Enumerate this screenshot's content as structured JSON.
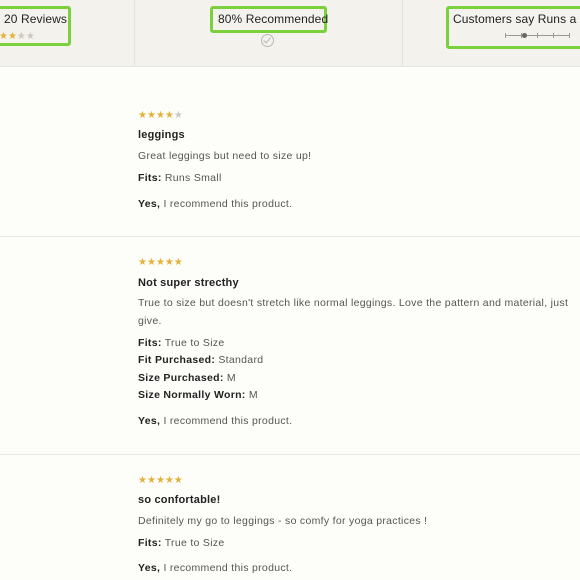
{
  "summary": {
    "reviews_label": "20 Reviews",
    "average_rating": 3,
    "recommended_label": "80% Recommended",
    "fit_label": "Customers say Runs a litt",
    "fit_position": 0.3,
    "highlight_color": "#7bd03d"
  },
  "reviews": [
    {
      "rating": 4,
      "title": "leggings",
      "body": [
        "Great leggings but need to size up!"
      ],
      "attributes": [
        {
          "key": "Fits:",
          "value": "Runs Small"
        }
      ],
      "recommend_key": "Yes,",
      "recommend_text": "I recommend this product."
    },
    {
      "rating": 5,
      "title": "Not super strecthy",
      "body": [
        "True to size but doesn't stretch like normal leggings. Love the pattern and material, just",
        "give."
      ],
      "attributes": [
        {
          "key": "Fits:",
          "value": "True to Size"
        },
        {
          "key": "Fit Purchased:",
          "value": "Standard"
        },
        {
          "key": "Size Purchased:",
          "value": "M"
        },
        {
          "key": "Size Normally Worn:",
          "value": "M"
        }
      ],
      "recommend_key": "Yes,",
      "recommend_text": "I recommend this product."
    },
    {
      "rating": 5,
      "title": "so confortable!",
      "body": [
        "Definitely my go to leggings - so comfy for yoga practices !"
      ],
      "attributes": [
        {
          "key": "Fits:",
          "value": "True to Size"
        }
      ],
      "recommend_key": "Yes,",
      "recommend_text": "I recommend this product."
    }
  ]
}
